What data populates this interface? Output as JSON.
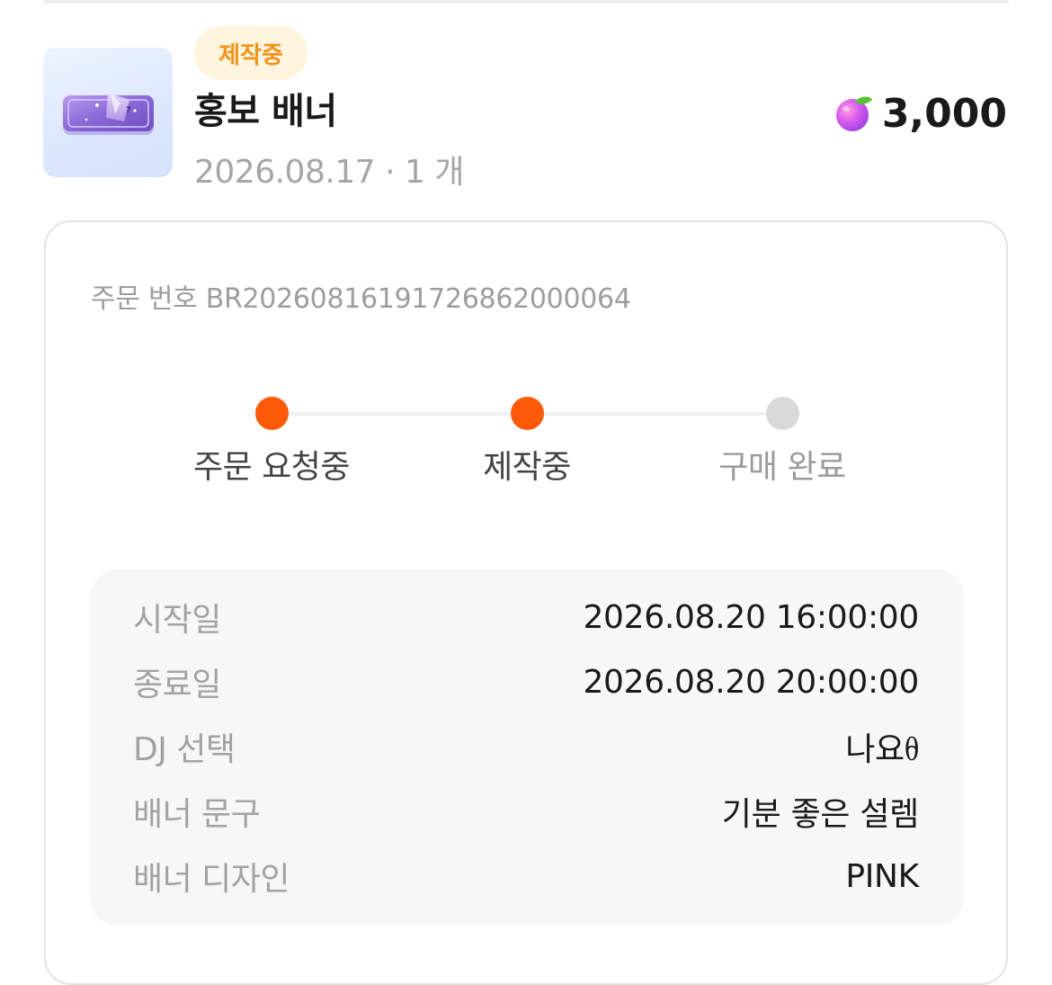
{
  "order": {
    "status_badge": "제작중",
    "product_name": "홍보 배너",
    "date": "2026.08.17",
    "separator": "·",
    "quantity": "1 개",
    "price": "3,000",
    "currency_icon": "peach-icon",
    "order_number_label": "주문 번호",
    "order_number": "BR20260816191726862000064"
  },
  "progress": {
    "steps": [
      {
        "label": "주문 요청중",
        "done": true
      },
      {
        "label": "제작중",
        "done": true
      },
      {
        "label": "구매 완료",
        "done": false
      }
    ],
    "colors": {
      "active": "#ff5a0a",
      "inactive": "#d9d9d9",
      "active_text": "#444444",
      "inactive_text": "#9b9b9b"
    }
  },
  "details": [
    {
      "key": "시작일",
      "value": "2026.08.20 16:00:00"
    },
    {
      "key": "종료일",
      "value": "2026.08.20 20:00:00"
    },
    {
      "key": "DJ 선택",
      "value": "나요ᦲ"
    },
    {
      "key": "배너 문구",
      "value": "기분 좋은 설렘"
    },
    {
      "key": "배너 디자인",
      "value": "PINK"
    }
  ]
}
